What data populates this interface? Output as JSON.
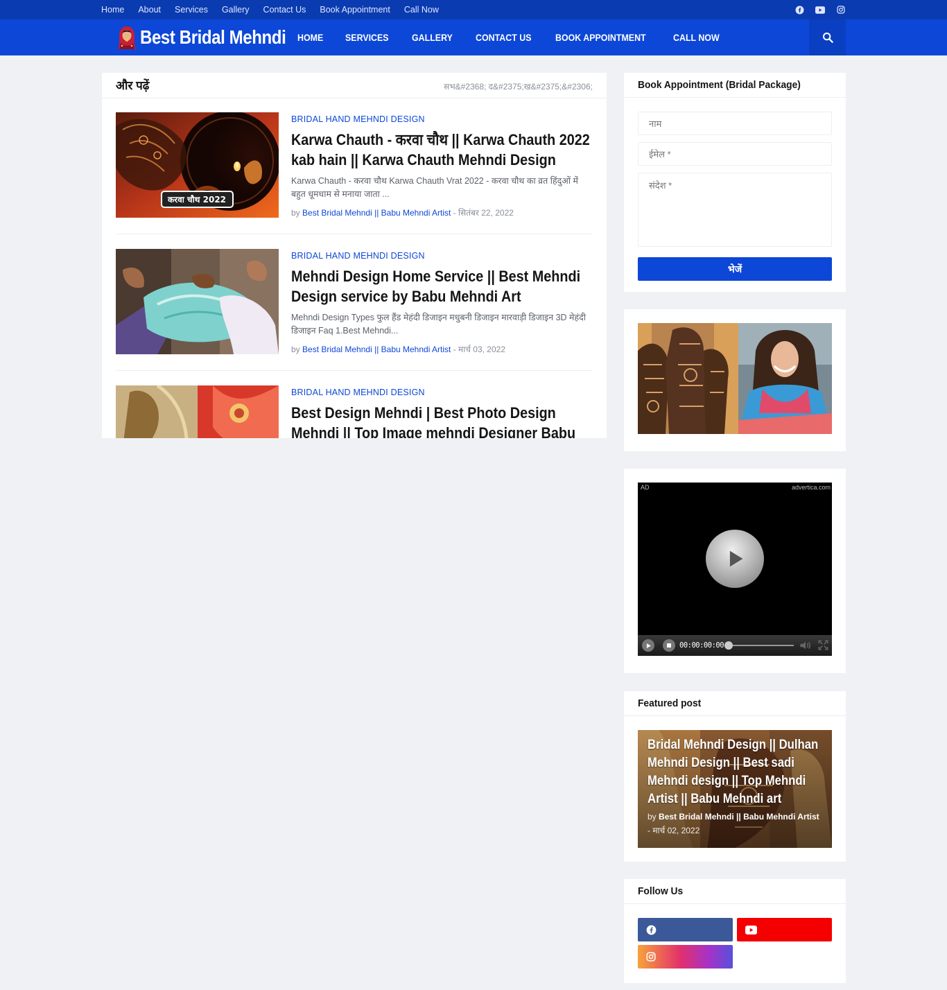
{
  "topbar": {
    "links": [
      "Home",
      "About",
      "Services",
      "Gallery",
      "Contact Us",
      "Book Appointment",
      "Call Now"
    ],
    "social_icons": [
      "facebook-icon",
      "youtube-icon",
      "instagram-icon"
    ]
  },
  "header": {
    "logo_text": "Best Bridal Mehndi",
    "nav": [
      "HOME",
      "SERVICES",
      "GALLERY",
      "CONTACT US",
      "BOOK APPOINTMENT",
      "CALL NOW"
    ],
    "search_icon": "search-icon"
  },
  "main": {
    "title": "और पढ़ें",
    "more_link": "सभ&#2368; द&#2375;ख&#2375;&#2306;",
    "posts": [
      {
        "category": "BRIDAL HAND MEHNDI DESIGN",
        "title": "Karwa Chauth - करवा चौथ || Karwa Chauth 2022 kab hain || Karwa Chauth Mehndi Design",
        "snippet": "Karwa Chauth - करवा चौथ   Karwa Chauth Vrat 2022 - करवा चौथ का व्रत हिंदुओं में बहुत धूमधाम से मनाया जाता ...",
        "by": "by",
        "author": "Best Bridal Mehndi || Babu Mehndi Artist",
        "date": "- सितंबर 22, 2022",
        "thumb_badge": "करवा चौथ 2022"
      },
      {
        "category": "BRIDAL HAND MEHNDI DESIGN",
        "title": "Mehndi Design Home Service || Best Mehndi Design service by Babu Mehndi Art",
        "snippet": "Mehndi Design Types  फुल हैंड मेहंदी डिजाइन मधुबनी डिजाइन मारवाड़ी डिजाइन 3D मेहंदी डिजाइन Faq 1.Best Mehndi...",
        "by": "by",
        "author": "Best Bridal Mehndi || Babu Mehndi Artist",
        "date": "- मार्च 03, 2022"
      },
      {
        "category": "BRIDAL HAND MEHNDI DESIGN",
        "title": "Best Design Mehndi | Best Photo Design Mehndi || Top Image mehndi Designer Babu mehndi artist",
        "snippet": "",
        "by": "",
        "author": "",
        "date": ""
      }
    ]
  },
  "sidebar": {
    "appointment": {
      "title": "Book Appointment (Bridal Package)",
      "name_placeholder": "नाम",
      "email_placeholder": "ईमेल *",
      "message_placeholder": "संदेश *",
      "send_label": "भेजें"
    },
    "video_ad": {
      "ad_label": "AD",
      "brand": "advertica.com",
      "time": "00:00:00:00"
    },
    "featured": {
      "heading": "Featured post",
      "title": "Bridal Mehndi Design || Dulhan Mehndi Design || Best sadi Mehndi design || Top Mehndi Artist || Babu Mehndi art",
      "by": "by",
      "author": "Best Bridal Mehndi || Babu Mehndi Artist",
      "date": "- मार्च 02, 2022"
    },
    "follow": {
      "heading": "Follow Us",
      "buttons": [
        {
          "icon": "facebook-icon",
          "color": "#3b5998"
        },
        {
          "icon": "youtube-icon",
          "color": "#f50000"
        },
        {
          "icon": "instagram-icon",
          "color": "#e1306c"
        }
      ]
    }
  },
  "colors": {
    "topbar": "#0a3bb0",
    "header": "#0d47d7",
    "accent": "#0d47d7",
    "page_bg": "#eff1f5"
  }
}
